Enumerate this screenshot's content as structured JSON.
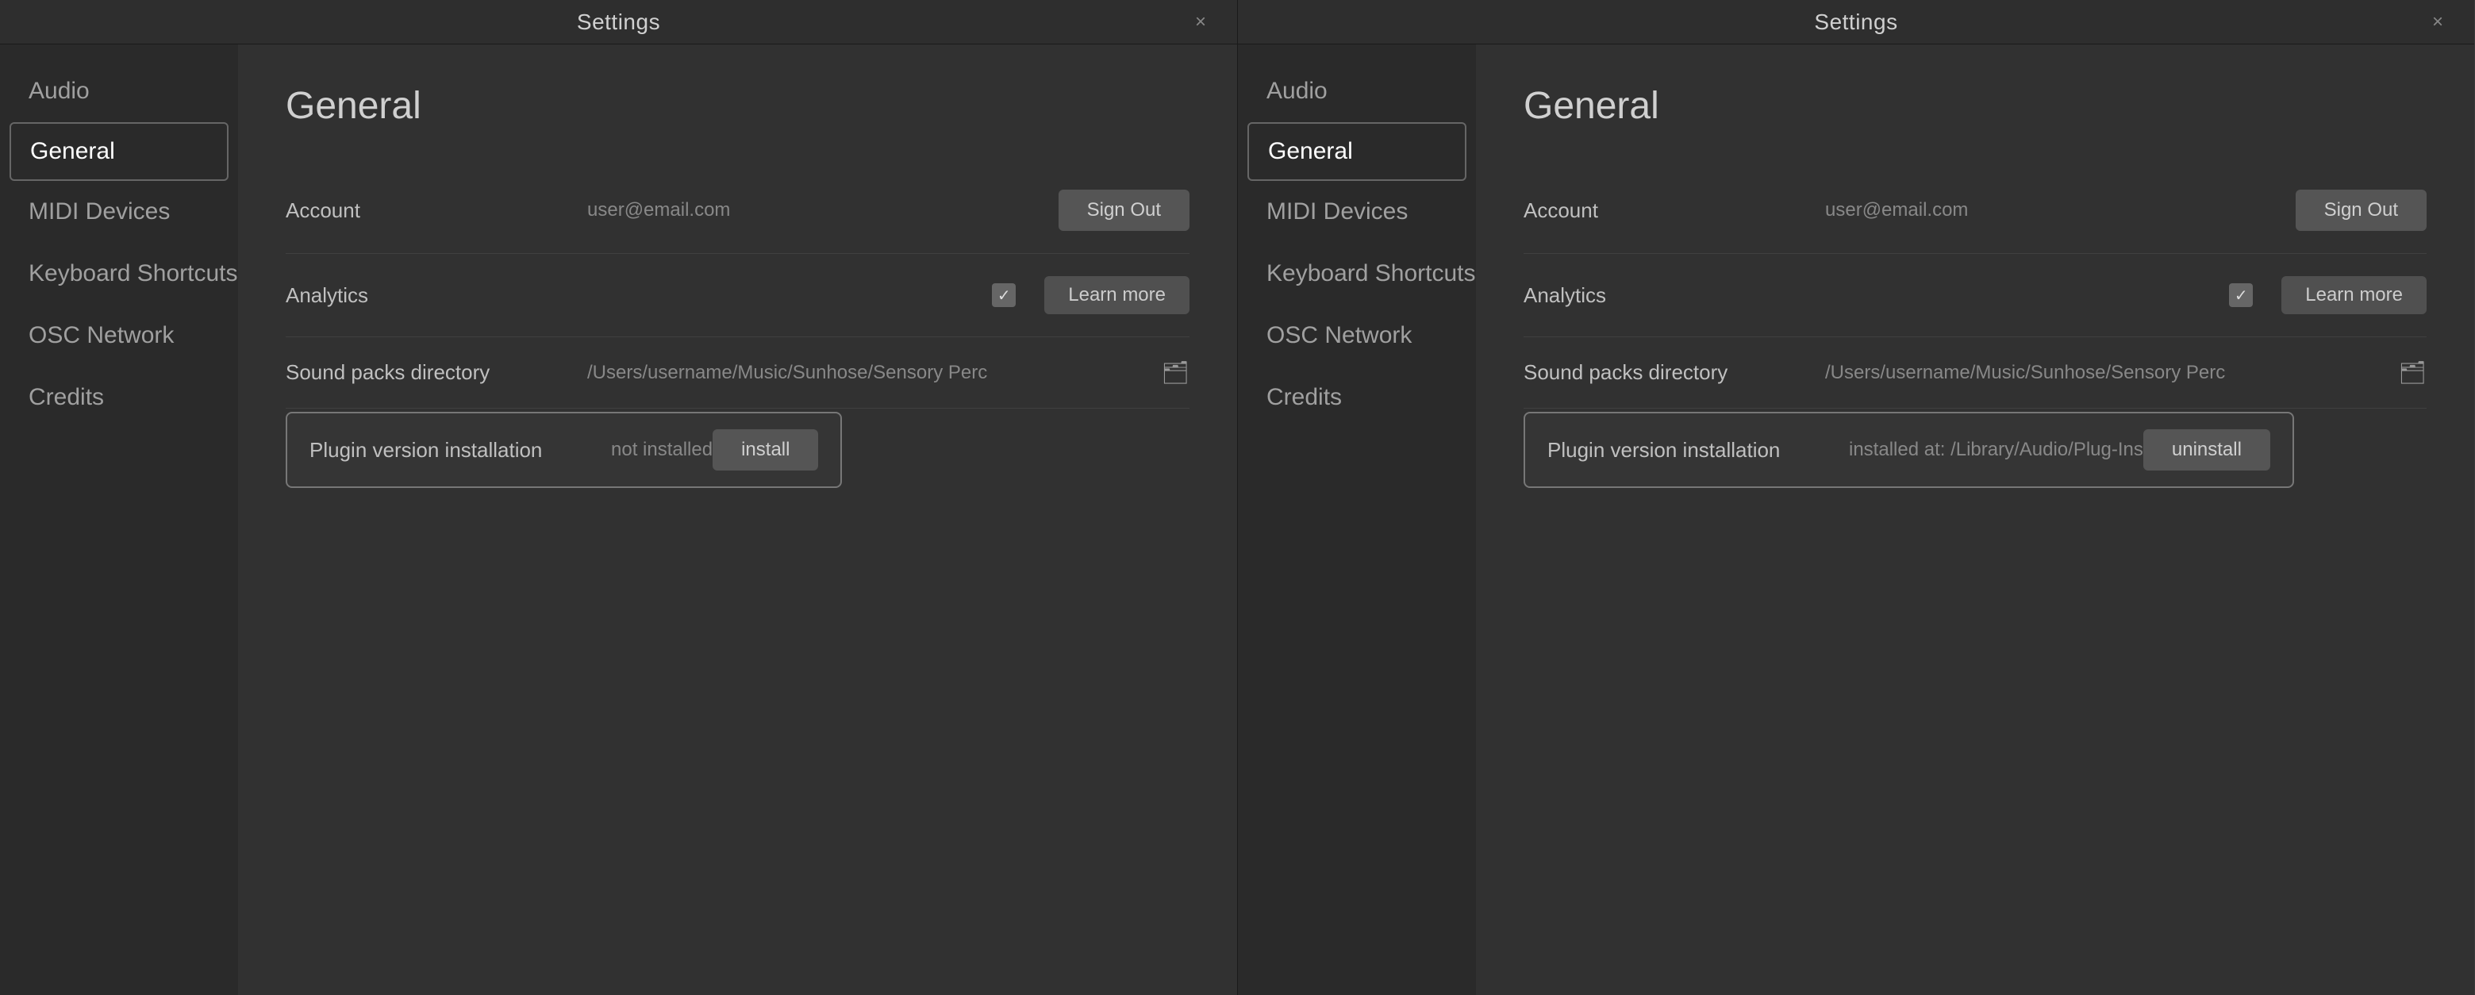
{
  "windows": [
    {
      "id": "window-left",
      "title": "Settings",
      "close_label": "×",
      "sidebar": {
        "items": [
          {
            "id": "audio",
            "label": "Audio",
            "active": false
          },
          {
            "id": "general",
            "label": "General",
            "active": true
          },
          {
            "id": "midi-devices",
            "label": "MIDI Devices",
            "active": false
          },
          {
            "id": "keyboard-shortcuts",
            "label": "Keyboard Shortcuts",
            "active": false
          },
          {
            "id": "osc-network",
            "label": "OSC Network",
            "active": false
          },
          {
            "id": "credits",
            "label": "Credits",
            "active": false
          }
        ]
      },
      "main": {
        "section_title": "General",
        "rows": [
          {
            "id": "account",
            "label": "Account",
            "value": "user@email.com",
            "action_label": "Sign Out",
            "type": "account"
          },
          {
            "id": "analytics",
            "label": "Analytics",
            "value": "",
            "checkbox_checked": true,
            "action_label": "Learn more",
            "type": "analytics"
          },
          {
            "id": "sound-packs",
            "label": "Sound packs directory",
            "value": "/Users/username/Music/Sunhose/Sensory Perc",
            "type": "directory"
          },
          {
            "id": "plugin-version",
            "label": "Plugin version installation",
            "status": "not installed",
            "action_label": "install",
            "type": "plugin-not-installed"
          }
        ]
      }
    },
    {
      "id": "window-right",
      "title": "Settings",
      "close_label": "×",
      "sidebar": {
        "items": [
          {
            "id": "audio",
            "label": "Audio",
            "active": false
          },
          {
            "id": "general",
            "label": "General",
            "active": true
          },
          {
            "id": "midi-devices",
            "label": "MIDI Devices",
            "active": false
          },
          {
            "id": "keyboard-shortcuts",
            "label": "Keyboard Shortcuts",
            "active": false
          },
          {
            "id": "osc-network",
            "label": "OSC Network",
            "active": false
          },
          {
            "id": "credits",
            "label": "Credits",
            "active": false
          }
        ]
      },
      "main": {
        "section_title": "General",
        "rows": [
          {
            "id": "account",
            "label": "Account",
            "value": "user@email.com",
            "action_label": "Sign Out",
            "type": "account"
          },
          {
            "id": "analytics",
            "label": "Analytics",
            "value": "",
            "checkbox_checked": true,
            "action_label": "Learn more",
            "type": "analytics"
          },
          {
            "id": "sound-packs",
            "label": "Sound packs directory",
            "value": "/Users/username/Music/Sunhose/Sensory Perc",
            "type": "directory"
          },
          {
            "id": "plugin-version",
            "label": "Plugin version installation",
            "status": "installed at: /Library/Audio/Plug-Ins",
            "action_label": "uninstall",
            "type": "plugin-installed"
          }
        ]
      }
    }
  ]
}
